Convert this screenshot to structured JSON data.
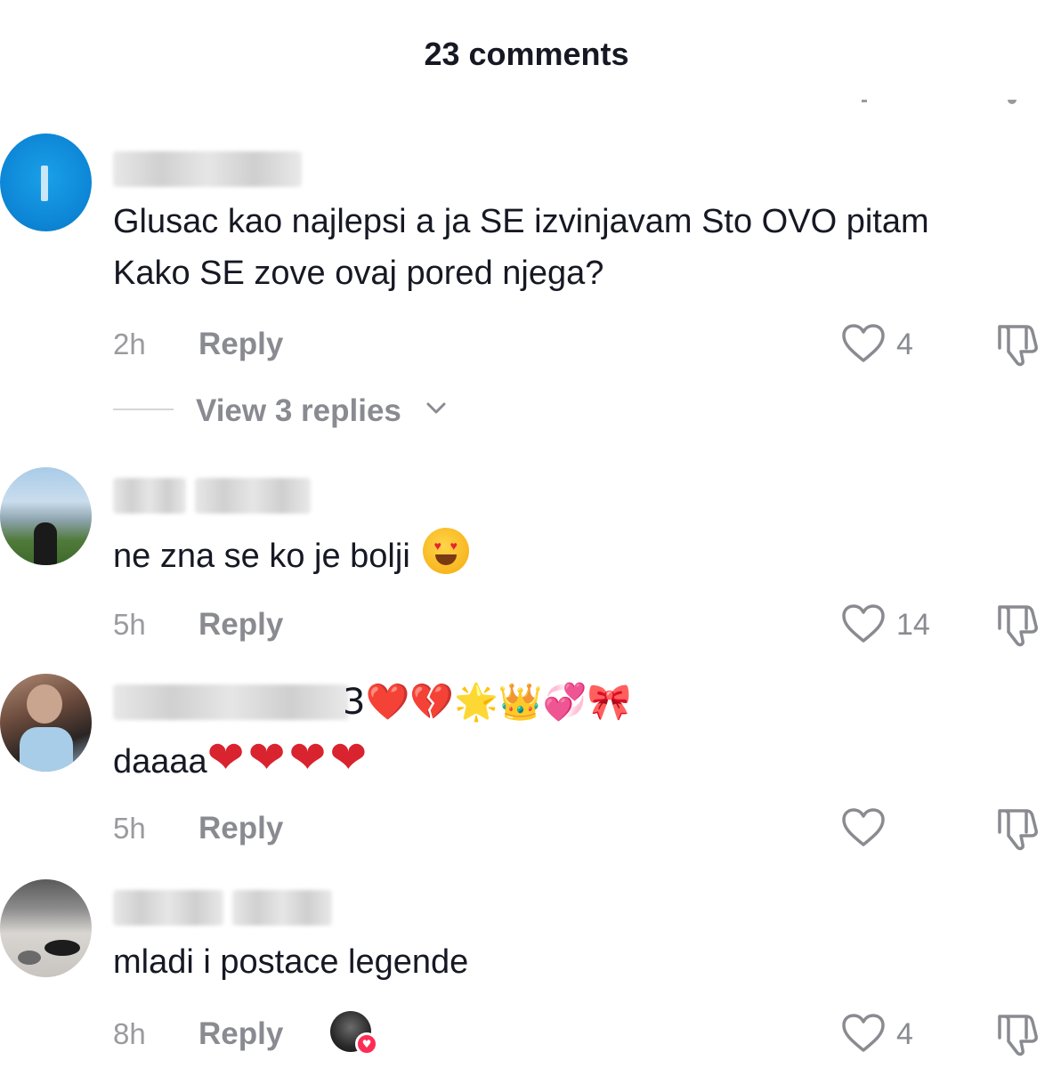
{
  "header": {
    "title": "23 comments"
  },
  "comments": [
    {
      "text": "Glusac kao najlepsi a ja SE izvinjavam Sto OVO pitam Kako SE zove ovaj pored njega?",
      "time": "2h",
      "reply_label": "Reply",
      "likes": "4",
      "view_replies": "View 3 replies"
    },
    {
      "text": "ne zna se ko je bolji",
      "time": "5h",
      "reply_label": "Reply",
      "likes": "14"
    },
    {
      "username_emoji": "3❤️💔🌟👑💞🎀",
      "text": "daaaa",
      "text_emoji": "❤❤❤❤",
      "time": "5h",
      "reply_label": "Reply",
      "likes": ""
    },
    {
      "text": "mladi i postace legende",
      "time": "8h",
      "reply_label": "Reply",
      "likes": "4"
    }
  ],
  "icons": {
    "like": "heart-outline-icon",
    "dislike": "thumbs-down-outline-icon",
    "chevron": "chevron-down-icon",
    "creator_like": "creator-liked-badge"
  },
  "colors": {
    "text": "#161823",
    "muted": "#8a8b91",
    "creator_heart": "#fe2c55"
  }
}
